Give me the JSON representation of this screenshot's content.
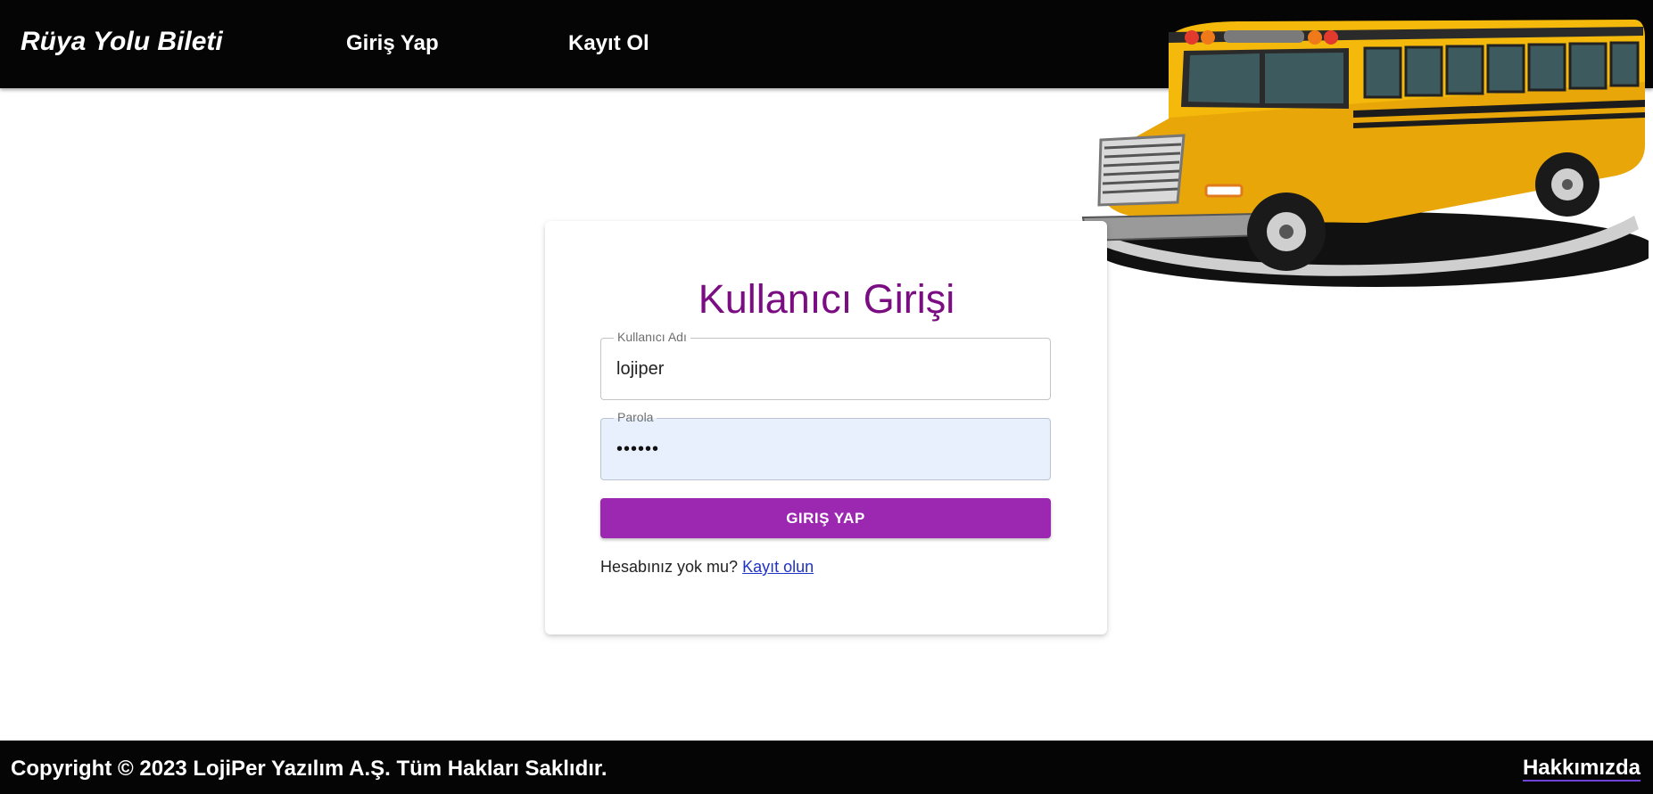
{
  "navbar": {
    "brand": "Rüya Yolu Bileti",
    "links": [
      "Giriş Yap",
      "Kayıt Ol"
    ]
  },
  "login": {
    "title": "Kullanıcı Girişi",
    "username_label": "Kullanıcı Adı",
    "username_value": "lojiper",
    "password_label": "Parola",
    "password_value": "••••••",
    "submit_label": "GIRIŞ YAP",
    "no_account_text": "Hesabınız yok mu?",
    "register_link": "Kayıt olun"
  },
  "footer": {
    "copyright": "Copyright © 2023 LojiPer Yazılım A.Ş. Tüm Hakları Saklıdır.",
    "about_link": "Hakkımızda"
  },
  "colors": {
    "title": "#7b0d83",
    "button": "#9c27b0",
    "bars": "#050505",
    "autofill": "#e8f0fe",
    "link": "#1f32c8"
  },
  "icons": [
    "school-bus-illustration"
  ]
}
